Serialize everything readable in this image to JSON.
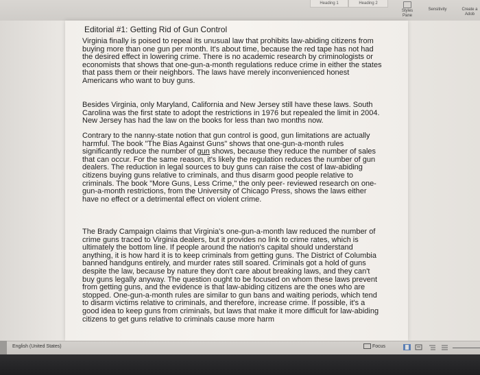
{
  "ribbon": {
    "styles": [
      "Heading 1",
      "Heading 2"
    ],
    "buttons": [
      {
        "label": "Styles\nPane",
        "icon": "styles-pane-icon"
      },
      {
        "label": "Sensitivity",
        "icon": "sensitivity-icon"
      },
      {
        "label": "Create a\nAdob",
        "icon": "adobe-pdf-icon"
      }
    ]
  },
  "document": {
    "title": "Editorial #1: Getting Rid of Gun Control",
    "paragraphs": [
      "Virginia finally is poised to repeal its unusual law that prohibits law-abiding citizens from buying more than one gun per month. It's about time, because the red tape has not had the desired effect in lowering crime. There is no academic research by criminologists or economists that shows that one-gun-a-month regulations reduce crime in either the states that pass them or their neighbors. The laws have merely inconvenienced honest Americans who want to buy guns.",
      "Besides Virginia, only Maryland, California and New Jersey still have these laws. South Carolina was the first state to adopt the restrictions in 1976 but repealed the limit in 2004. New Jersey has had the law on the books for less than two months now.",
      {
        "before": "Contrary to the nanny-state notion that gun control is good, gun limitations are actually harmful. The book \"The Bias Against Guns\" shows that one-gun-a-month rules significantly reduce the number of ",
        "underlined": "gun",
        "after": " shows, because they reduce the number of sales that can occur. For the same reason, it's likely the regulation reduces the number of gun dealers. The reduction in legal sources to buy guns can raise the cost of law-abiding citizens buying guns relative to criminals, and thus disarm good people relative to criminals. The book \"More Guns, Less Crime,\" the only peer- reviewed research on one-gun-a-month restrictions, from the University of Chicago Press, shows the laws either have no effect or a detrimental effect on violent crime."
      },
      "The Brady Campaign claims that Virginia's one-gun-a-month law reduced the number of crime guns traced to Virginia dealers, but it provides no link to crime rates, which is ultimately the bottom line. If people around the nation's capital should understand anything, it is how hard it is to keep criminals from getting guns. The District of Columbia banned handguns entirely, and murder rates still soared. Criminals got a hold of guns despite the law, because by nature they don't care about breaking laws, and they can't buy guns legally anyway. The question ought to be focused on whom these laws prevent from getting guns, and the evidence is that law-abiding citizens are the ones who are stopped. One-gun-a-month rules are similar to gun bans and waiting periods, which tend to disarm victims relative to criminals, and therefore, increase crime. If possible, it's a good idea to keep guns from criminals, but laws that make it more difficult for law-abiding citizens to get guns relative to criminals cause more harm"
    ]
  },
  "status_bar": {
    "language": "English (United States)",
    "focus_label": "Focus"
  }
}
